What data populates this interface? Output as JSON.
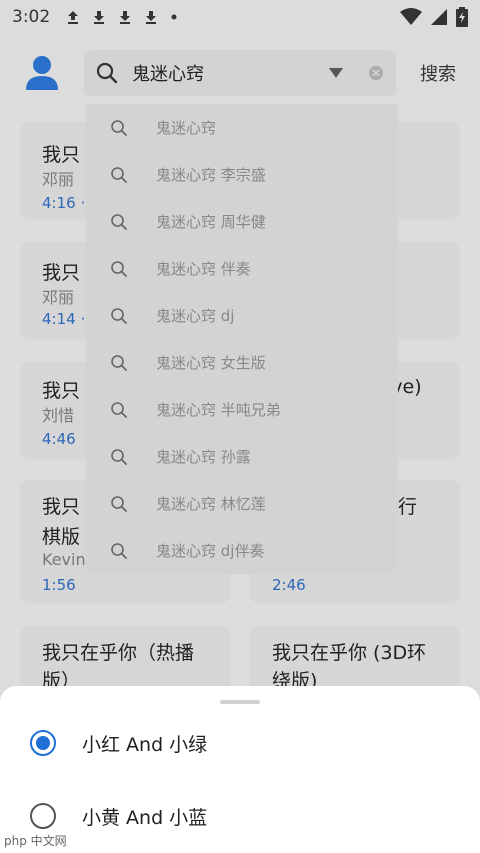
{
  "status_bar": {
    "time": "3:02",
    "notification_icons": [
      "upload-arrow-icon",
      "download-arrow-icon",
      "download-arrow-icon",
      "download-arrow-icon",
      "dot-icon"
    ],
    "system_icons": [
      "wifi-icon",
      "signal-icon",
      "battery-icon"
    ]
  },
  "header": {
    "search_value": "鬼迷心窍",
    "search_button_label": "搜索"
  },
  "suggestions": [
    "鬼迷心窍",
    "鬼迷心窍 李宗盛",
    "鬼迷心窍 周华健",
    "鬼迷心窍 伴奏",
    "鬼迷心窍 dj",
    "鬼迷心窍 女生版",
    "鬼迷心窍 半吨兄弟",
    "鬼迷心窍 孙露",
    "鬼迷心窍 林忆莲",
    "鬼迷心窍 dj伴奏"
  ],
  "results": [
    {
      "title": "我只",
      "artist": "邓丽",
      "duration": "4:16 ·"
    },
    {
      "title": "我只",
      "artist": "邓丽",
      "duration": "4:14 ·"
    },
    {
      "title": "我只",
      "title_right": "ive)",
      "artist": "刘惜",
      "duration": "4:46"
    },
    {
      "title": "我只",
      "title_line2": "棋版",
      "title_right": "行",
      "artist": "Kevin",
      "duration": "1:56",
      "duration_right": "2:46"
    },
    {
      "title": "我只在乎你（热播",
      "title_line2": "版）"
    },
    {
      "title": "我只在乎你 (3D环",
      "title_line2": "绕版)"
    }
  ],
  "sheet": {
    "options": [
      {
        "label": "小红 And 小绿",
        "selected": true
      },
      {
        "label": "小黄 And 小蓝",
        "selected": false
      }
    ]
  },
  "watermark": "php 中文网",
  "colors": {
    "accent": "#1f6fd6",
    "duration": "#2c66b8",
    "dim_background": "#dcdcdc"
  }
}
